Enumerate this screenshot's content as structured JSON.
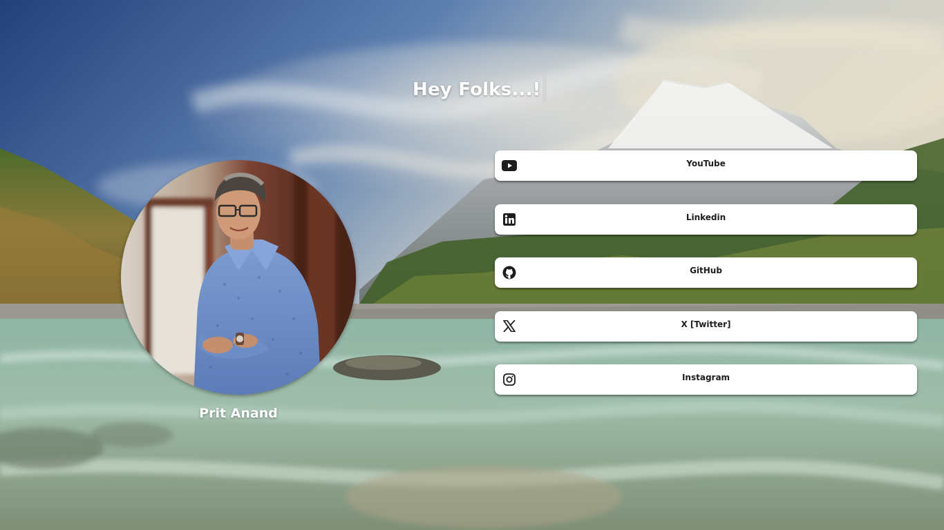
{
  "header": {
    "greeting": "Hey Folks...!"
  },
  "profile": {
    "name": "Prit Anand",
    "photo_alt": "Profile photo"
  },
  "links": [
    {
      "label": "YouTube",
      "icon": "youtube-icon"
    },
    {
      "label": "Linkedin",
      "icon": "linkedin-icon"
    },
    {
      "label": "GitHub",
      "icon": "github-icon"
    },
    {
      "label": "X [Twitter]",
      "icon": "x-twitter-icon"
    },
    {
      "label": "Instagram",
      "icon": "instagram-icon"
    }
  ],
  "colors": {
    "button_bg": "#ffffff",
    "button_text": "#1d1d1d",
    "heading_text": "#ffffff"
  }
}
